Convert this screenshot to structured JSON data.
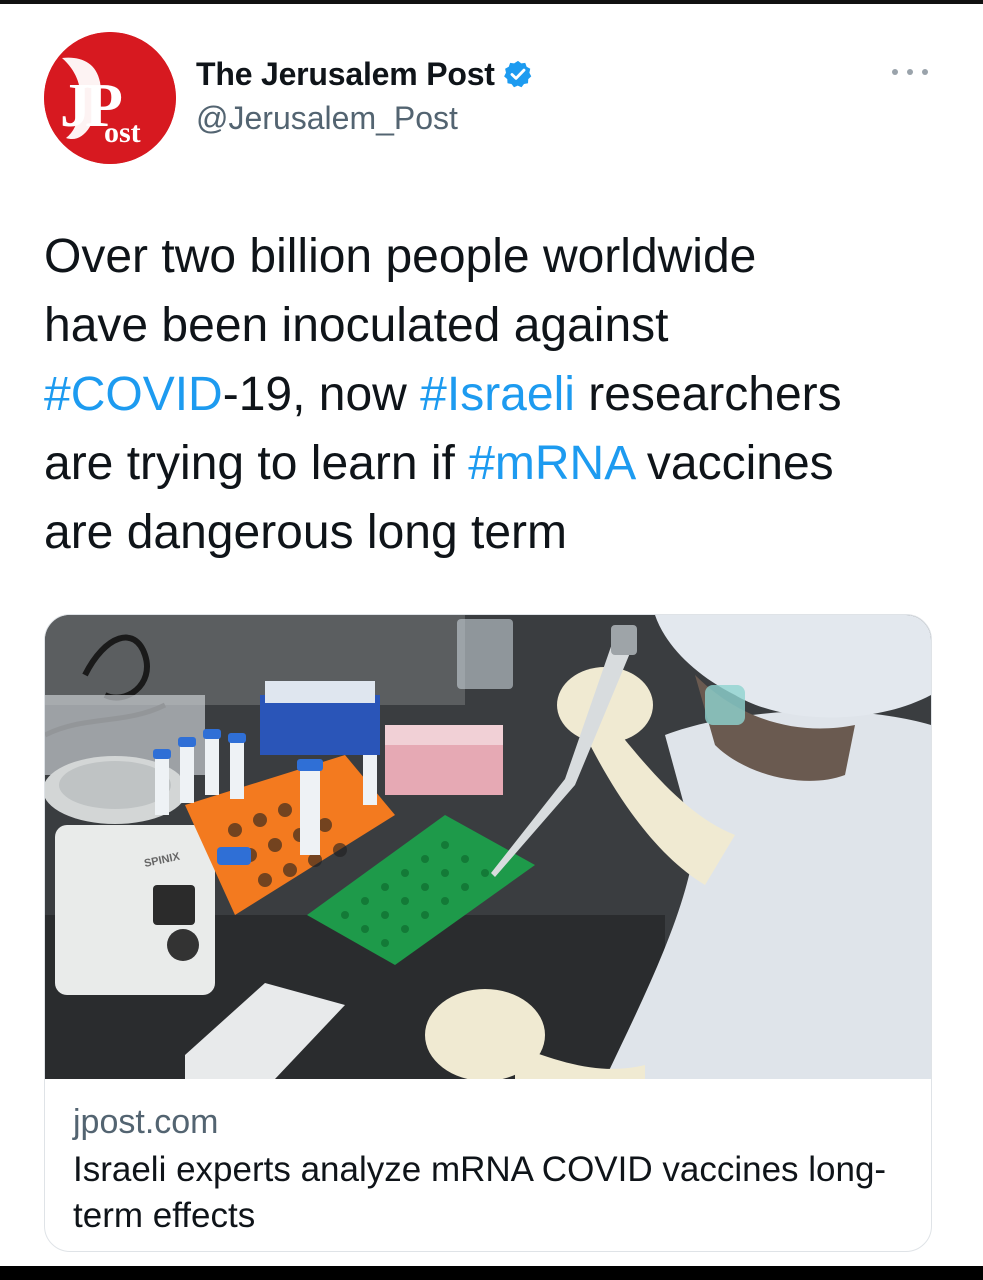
{
  "account": {
    "display_name": "The Jerusalem Post",
    "handle": "@Jerusalem_Post",
    "avatar_text_main": "JP",
    "avatar_text_sub": "ost",
    "verified": true
  },
  "tweet": {
    "lines": [
      [
        {
          "t": "Over two billion people worldwide",
          "h": false
        }
      ],
      [
        {
          "t": "have been inoculated against",
          "h": false
        }
      ],
      [
        {
          "t": "#COVID",
          "h": true
        },
        {
          "t": "-19, now ",
          "h": false
        },
        {
          "t": "#Israeli",
          "h": true
        },
        {
          "t": " researchers",
          "h": false
        }
      ],
      [
        {
          "t": "are trying to learn if ",
          "h": false
        },
        {
          "t": "#mRNA",
          "h": true
        },
        {
          "t": " vaccines",
          "h": false
        }
      ],
      [
        {
          "t": "are dangerous long term",
          "h": false
        }
      ]
    ]
  },
  "card": {
    "domain": "jpost.com",
    "title": "Israeli experts analyze mRNA COVID vaccines long-term effects",
    "image_text": "SPINIX"
  },
  "colors": {
    "hashtag": "#1d9bf0",
    "verified_badge": "#1d9bf0",
    "avatar_bg": "#d71920",
    "secondary_text": "#536471"
  },
  "icons": [
    "verified-badge-icon",
    "more-options-icon"
  ]
}
